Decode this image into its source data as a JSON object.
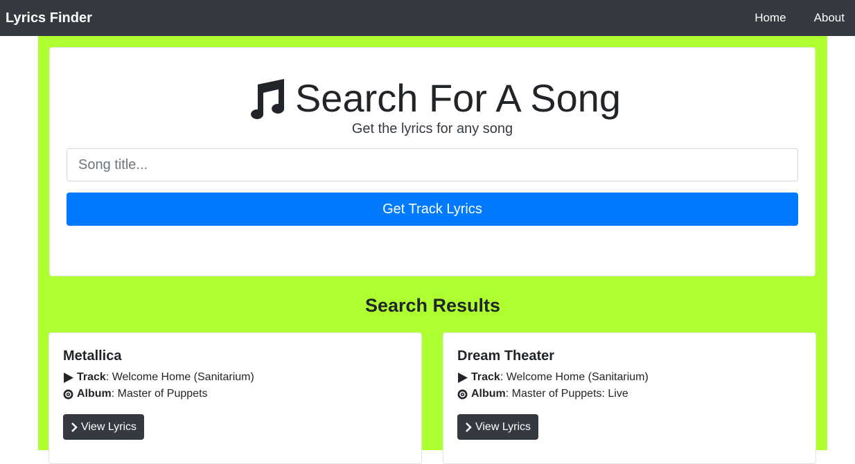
{
  "navbar": {
    "brand": "Lyrics Finder",
    "links": [
      "Home",
      "About"
    ]
  },
  "search": {
    "icon": "music-note-icon",
    "title": "Search For A Song",
    "subtitle": "Get the lyrics for any song",
    "placeholder": "Song title...",
    "value": "",
    "button_label": "Get Track Lyrics"
  },
  "results": {
    "title": "Search Results",
    "track_label": "Track",
    "album_label": "Album",
    "view_label": "View Lyrics",
    "items": [
      {
        "artist": "Metallica",
        "track": "Welcome Home (Sanitarium)",
        "album": "Master of Puppets"
      },
      {
        "artist": "Dream Theater",
        "track": "Welcome Home (Sanitarium)",
        "album": "Master of Puppets: Live"
      }
    ]
  },
  "colors": {
    "navbar_bg": "#343a40",
    "page_bg": "#adff2f",
    "primary": "#007bff",
    "dark_button": "#343a40"
  }
}
